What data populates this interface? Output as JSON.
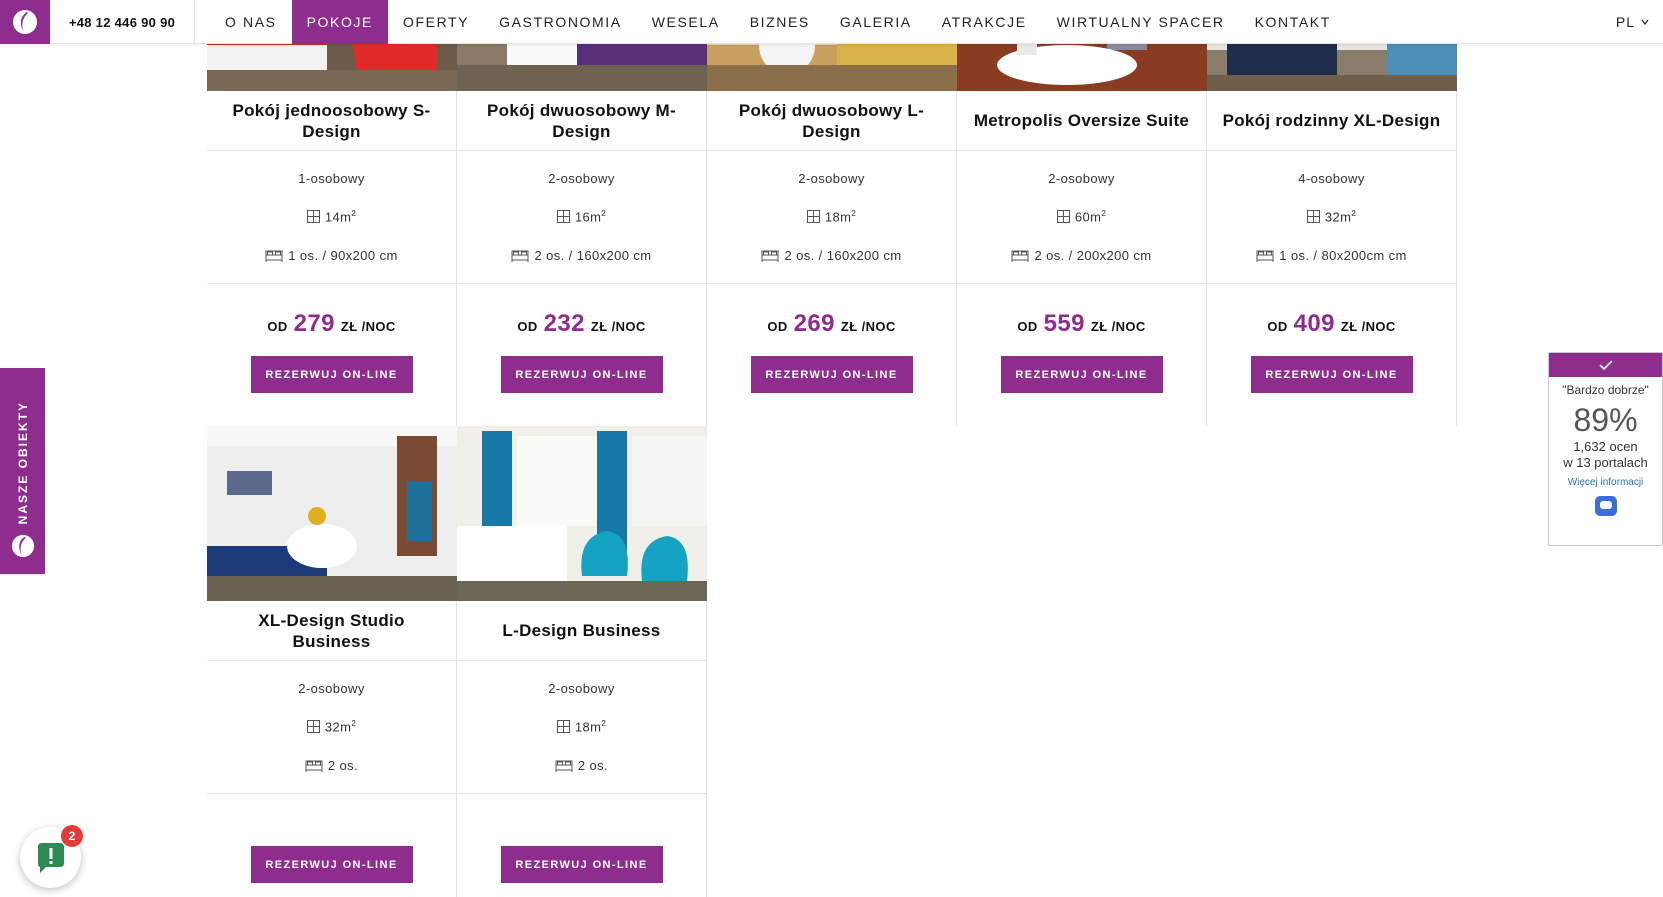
{
  "header": {
    "phone": "+48 12 446 90 90",
    "nav": [
      "O NAS",
      "POKOJE",
      "OFERTY",
      "GASTRONOMIA",
      "WESELA",
      "BIZNES",
      "GALERIA",
      "ATRAKCJE",
      "WIRTUALNY SPACER",
      "KONTAKT"
    ],
    "active_index": 1,
    "lang": "PL"
  },
  "side_tab": {
    "label": "NASZE OBIEKTY"
  },
  "rooms": [
    {
      "title": "Pokój jednoosobowy S-Design",
      "people": "1-osobowy",
      "area": "14m",
      "area_sup": "2",
      "bed": "1 os. / 90x200 cm",
      "price_prefix": "OD",
      "price": "279",
      "price_suffix": "ZŁ /NOC",
      "cta": "REZERWUJ ON-LINE"
    },
    {
      "title": "Pokój dwuosobowy M-Design",
      "people": "2-osobowy",
      "area": "16m",
      "area_sup": "2",
      "bed": "2 os. / 160x200 cm",
      "price_prefix": "OD",
      "price": "232",
      "price_suffix": "ZŁ /NOC",
      "cta": "REZERWUJ ON-LINE"
    },
    {
      "title": "Pokój dwuosobowy L-Design",
      "people": "2-osobowy",
      "area": "18m",
      "area_sup": "2",
      "bed": "2 os. / 160x200 cm",
      "price_prefix": "OD",
      "price": "269",
      "price_suffix": "ZŁ /NOC",
      "cta": "REZERWUJ ON-LINE"
    },
    {
      "title": "Metropolis Oversize Suite",
      "people": "2-osobowy",
      "area": "60m",
      "area_sup": "2",
      "bed": "2 os. / 200x200 cm",
      "price_prefix": "OD",
      "price": "559",
      "price_suffix": "ZŁ /NOC",
      "cta": "REZERWUJ ON-LINE"
    },
    {
      "title": "Pokój rodzinny XL-Design",
      "people": "4-osobowy",
      "area": "32m",
      "area_sup": "2",
      "bed": "1 os. / 80x200cm cm",
      "price_prefix": "OD",
      "price": "409",
      "price_suffix": "ZŁ /NOC",
      "cta": "REZERWUJ ON-LINE"
    },
    {
      "title": "XL-Design Studio Business",
      "people": "2-osobowy",
      "area": "32m",
      "area_sup": "2",
      "bed": "2 os.",
      "cta": "REZERWUJ ON-LINE"
    },
    {
      "title": "L-Design Business",
      "people": "2-osobowy",
      "area": "18m",
      "area_sup": "2",
      "bed": "2 os.",
      "cta": "REZERWUJ ON-LINE"
    }
  ],
  "rating": {
    "quote": "\"Bardzo dobrze\"",
    "percent": "89%",
    "count": "1,632 ocen",
    "portals": "w 13 portalach",
    "link": "Więcej informacji"
  },
  "chat": {
    "badge": "2"
  },
  "colors": {
    "brand": "#8e2d8e"
  }
}
